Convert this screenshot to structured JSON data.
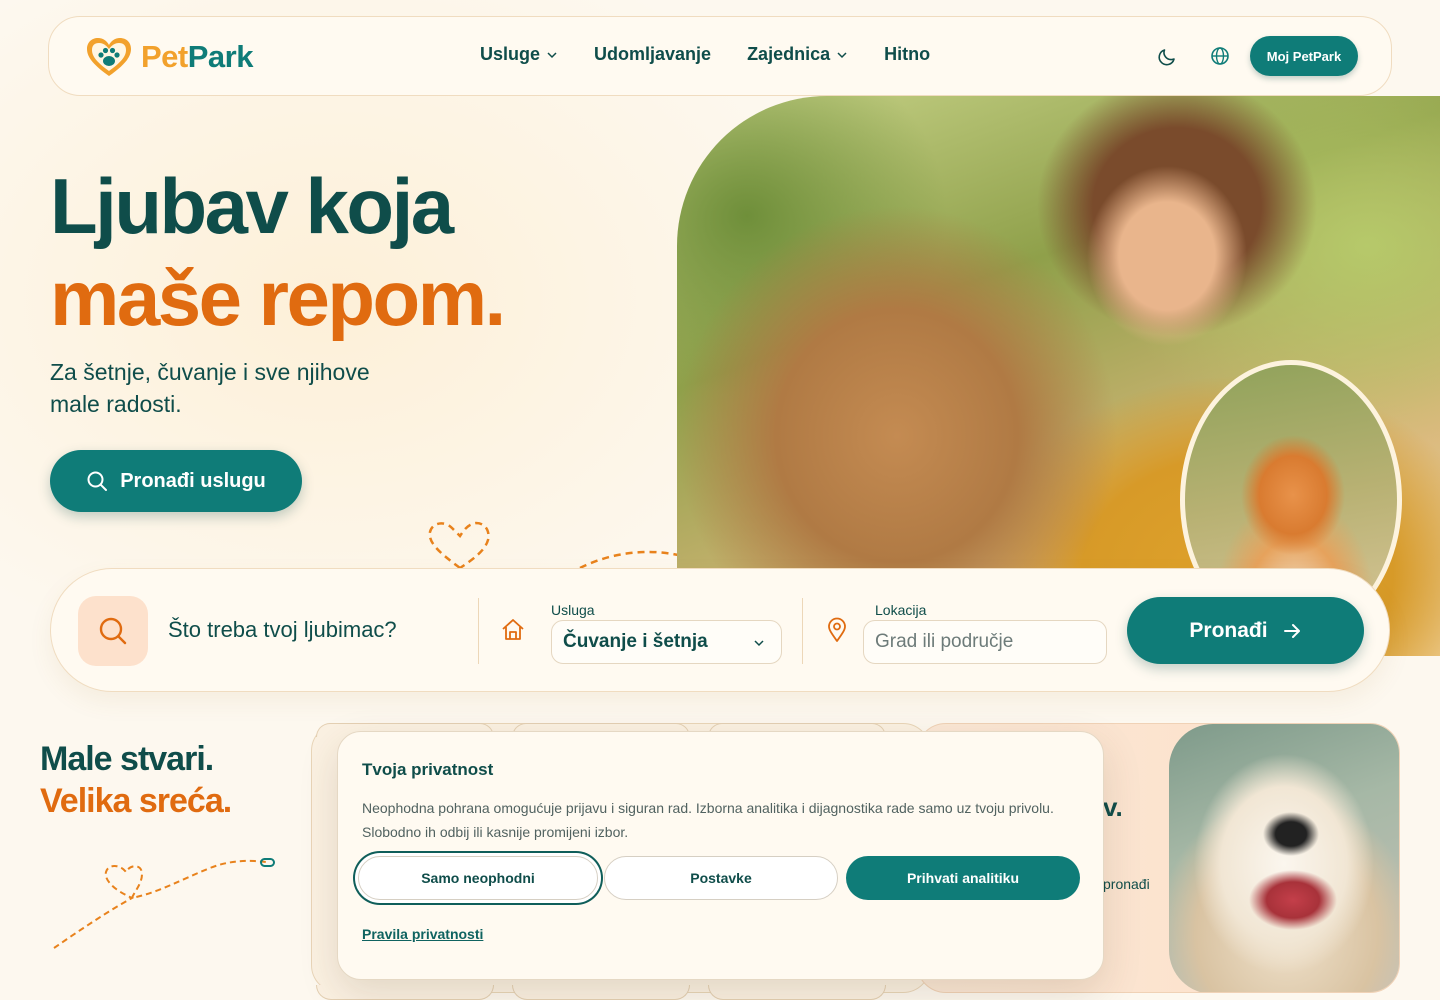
{
  "nav": {
    "brand_left": "Pet",
    "brand_right": "Park",
    "links": [
      {
        "label": "Usluge",
        "has_dropdown": true
      },
      {
        "label": "Udomljavanje",
        "has_dropdown": false
      },
      {
        "label": "Zajednica",
        "has_dropdown": true
      },
      {
        "label": "Hitno",
        "has_dropdown": false
      }
    ],
    "icons": [
      "moon-icon",
      "globe-icon"
    ],
    "account_button": "Moj PetPark"
  },
  "hero": {
    "title_line1": "Ljubav koja",
    "title_line2": "maše repom.",
    "subtitle": "Za šetnje, čuvanje i sve njihove male radosti.",
    "cta": "Pronađi uslugu"
  },
  "search": {
    "question": "Što treba tvoj ljubimac?",
    "service_label": "Usluga",
    "service_value": "Čuvanje i šetnja",
    "location_label": "Lokacija",
    "location_placeholder": "Grad ili područje",
    "submit": "Pronađi"
  },
  "lower": {
    "tagline_line1": "Male stvari.",
    "tagline_line2": "Velika sreća.",
    "promo_title_fragment": "v.",
    "promo_text_fragment": "pronađi"
  },
  "cookie": {
    "title": "Tvoja privatnost",
    "text": "Neophodna pohrana omogućuje prijavu i siguran rad. Izborna analitika i dijagnostika rade samo uz tvoju privolu. Slobodno ih odbij ili kasnije promijeni izbor.",
    "btn_essential": "Samo neophodni",
    "btn_settings": "Postavke",
    "btn_accept": "Prihvati analitiku",
    "policy_link": "Pravila privatnosti"
  },
  "colors": {
    "teal": "#0f7c78",
    "dark_teal": "#0f4d4a",
    "orange": "#e06b10",
    "cream": "#fdf8ef",
    "peach": "#fde1cc"
  }
}
